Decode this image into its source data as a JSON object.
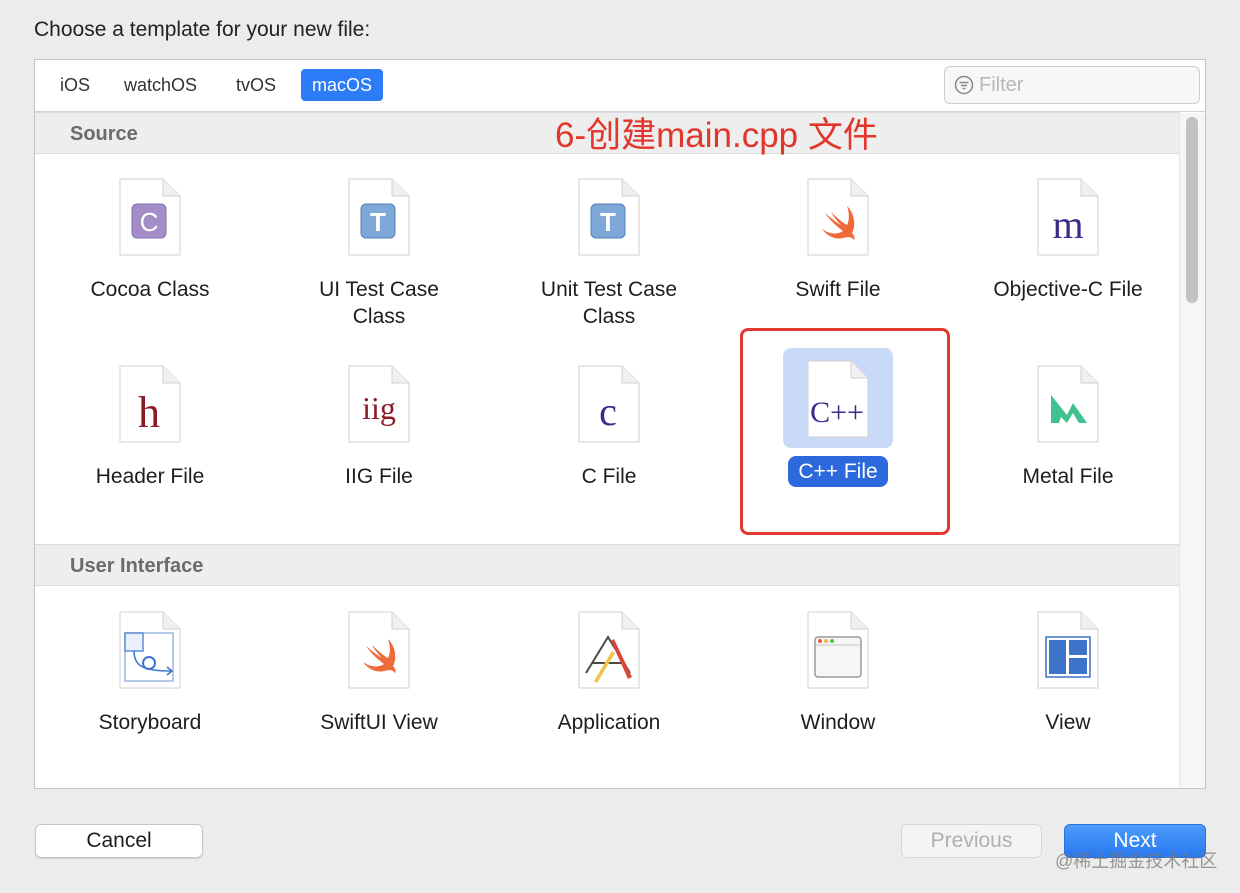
{
  "dialog": {
    "title": "Choose a template for your new file:"
  },
  "tabs": [
    {
      "label": "iOS"
    },
    {
      "label": "watchOS"
    },
    {
      "label": "tvOS"
    },
    {
      "label": "macOS"
    }
  ],
  "filter": {
    "placeholder": "Filter",
    "value": ""
  },
  "annotation": "6-创建main.cpp 文件",
  "sections": [
    {
      "title": "Source",
      "items": [
        {
          "label": "Cocoa Class",
          "icon": "cocoa-class-icon"
        },
        {
          "label": "UI Test Case Class",
          "icon": "ui-test-case-icon"
        },
        {
          "label": "Unit Test Case Class",
          "icon": "unit-test-case-icon"
        },
        {
          "label": "Swift File",
          "icon": "swift-icon"
        },
        {
          "label": "Objective-C File",
          "icon": "objective-c-icon"
        },
        {
          "label": "Header File",
          "icon": "header-file-icon"
        },
        {
          "label": "IIG File",
          "icon": "iig-file-icon"
        },
        {
          "label": "C File",
          "icon": "c-file-icon"
        },
        {
          "label": "C++ File",
          "icon": "cpp-file-icon"
        },
        {
          "label": "Metal File",
          "icon": "metal-file-icon"
        }
      ]
    },
    {
      "title": "User Interface",
      "items": [
        {
          "label": "Storyboard",
          "icon": "storyboard-icon"
        },
        {
          "label": "SwiftUI View",
          "icon": "swiftui-icon"
        },
        {
          "label": "Application",
          "icon": "application-icon"
        },
        {
          "label": "Window",
          "icon": "window-icon"
        },
        {
          "label": "View",
          "icon": "view-icon"
        }
      ]
    }
  ],
  "glyphs": {
    "c": "C",
    "t": "T",
    "m": "m",
    "h": "h",
    "iig": "iig",
    "c_small": "c",
    "cpp": "C++"
  },
  "buttons": {
    "cancel": "Cancel",
    "previous": "Previous",
    "next": "Next"
  },
  "watermark": "@稀土掘金技术社区",
  "colors": {
    "accent": "#2b7cf6",
    "selection": "#2b69dc",
    "annotation": "#e2352b"
  }
}
